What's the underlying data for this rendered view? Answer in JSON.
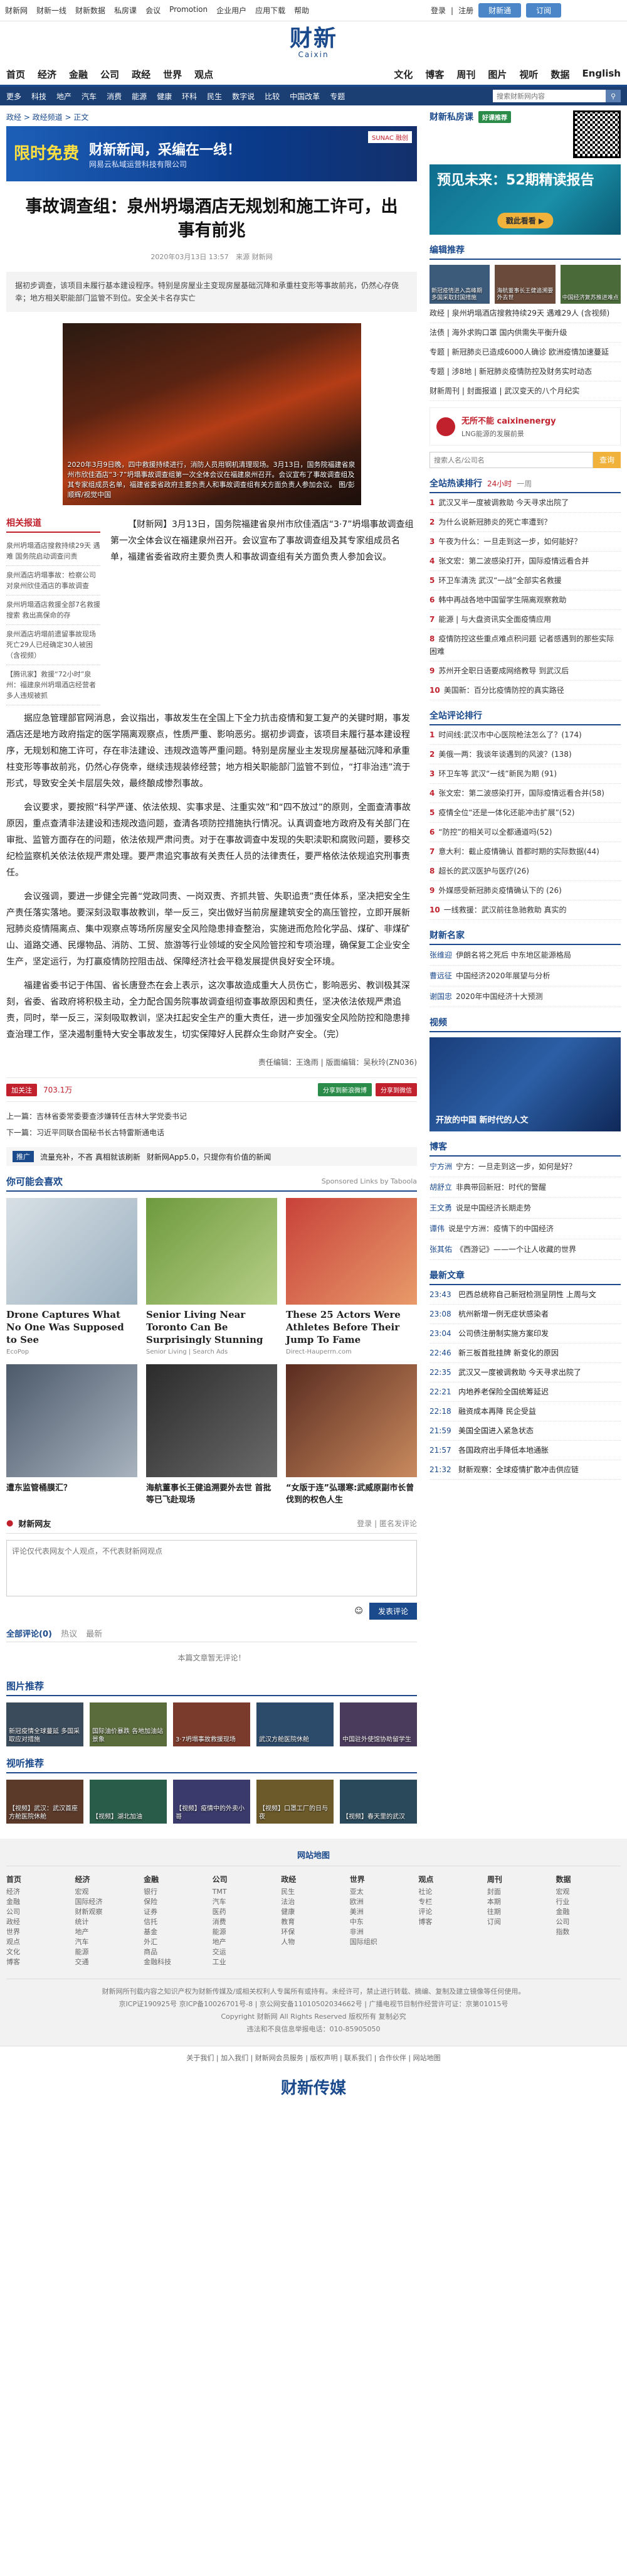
{
  "topbar": {
    "links": [
      "财新网",
      "财新一线",
      "财新数据",
      "私房课",
      "会议",
      "Promotion",
      "企业用户",
      "应用下载",
      "帮助"
    ],
    "login": "登录",
    "register": "注册",
    "btn1": "财新通",
    "btn2": "订阅"
  },
  "logo": {
    "cn": "财新",
    "en": "Caixin"
  },
  "mainnav": {
    "left": [
      "首页",
      "经济",
      "金融",
      "公司",
      "政经",
      "世界",
      "观点"
    ],
    "right": [
      "文化",
      "博客",
      "周刊",
      "图片",
      "视听",
      "数据",
      "English"
    ]
  },
  "subnav": {
    "items": [
      "更多",
      "科技",
      "地产",
      "汽车",
      "消费",
      "能源",
      "健康",
      "环科",
      "民生",
      "数字说",
      "比较",
      "中国改革",
      "专题"
    ],
    "search_placeholder": "搜索财新网内容"
  },
  "crumb": "政经 > 政经频道 > 正文",
  "banner": {
    "line1": "限时免费",
    "line2": "财新新闻，采编在一线！",
    "sub": "网易云私域运营科技有限公司",
    "tag": "SUNAC 融创"
  },
  "article": {
    "title": "事故调查组：泉州坍塌酒店无规划和施工许可，出事有前兆",
    "date": "2020年03月13日 13:57",
    "source": "来源 财新网",
    "summary": "据初步调查，该项目未履行基本建设程序。特别是房屋业主变现房屋基础沉降和承重柱变形等事故前兆，仍然心存侥幸；地方相关职能部门监管不到位。安全关卡名存实亡",
    "figure_caption": "2020年3月9日晚，四中救援持续进行，消防人员用钢机清理现场。3月13日，国务院福建省泉州市欣佳酒店“3·7”坍塌事故调查组第一次全体会议在福建泉州召开。会议宣布了事故调查组及其专家组成员名单，福建省委省政府主要负责人和事故调查组有关方面负责人参加会议。 图/彭顺辉/视觉中国",
    "related_title": "相关报道",
    "related": [
      "泉州坍塌酒店搜救持续29天 遇难 国务院启动调查问责",
      "泉州酒店坍塌事故：检察公司对泉州欣佳酒店的事故调查",
      "泉州坍塌酒店救援全部7名救援搜索 救出高保命的存",
      "泉州酒店坍塌前遗留事故现场 死亡29人已经确定30人被困（含视频）",
      "【腾讯家】救援“72小时”泉州：福建泉州坍塌酒店经营者 多人违规被抓"
    ],
    "lead": "【财新网】3月13日，国务院福建省泉州市欣佳酒店“3·7”坍塌事故调查组第一次全体会议在福建泉州召开。会议宣布了事故调查组及其专家组成员名单，福建省委省政府主要负责人和事故调查组有关方面负责人参加会议。",
    "paragraphs": [
      "据应急管理部官网消息，会议指出，事故发生在全国上下全力抗击疫情和复工复产的关键时期，事发酒店还是地方政府指定的医学隔离观察点，性质严重、影响恶劣。据初步调查，该项目未履行基本建设程序，无规划和施工许可，存在非法建设、违规改造等严重问题。特别是房屋业主发现房屋基础沉降和承重柱变形等事故前兆，仍然心存侥幸，继续违规装修经营；地方相关职能部门监管不到位，“打非治违”流于形式，导致安全关卡层层失效，最终酿成惨烈事故。",
      "会议要求，要按照“科学严谨、依法依规、实事求是、注重实效”和“四不放过”的原则，全面查清事故原因，重点查清非法建设和违规改造问题，查清各项防控措施执行情况。认真调查地方政府及有关部门在审批、监管方面存在的问题，依法依规严肃问责。对于在事故调查中发现的失职渎职和腐败问题，要移交纪检监察机关依法依规严肃处理。要严肃追究事故有关责任人员的法律责任，要严格依法依规追究刑事责任。",
      "会议强调，要进一步健全完善“党政同责、一岗双责、齐抓共管、失职追责”责任体系，坚决把安全生产责任落实落地。要深刻汲取事故教训，举一反三，突出做好当前房屋建筑安全的高压管控，立即开展新冠肺炎疫情隔离点、集中观察点等场所房屋安全风险隐患排查整治，实施进而危险化学品、煤矿、非煤矿山、道路交通、民爆物品、消防、工贸、旅游等行业领域的安全风险管控和专项治理，确保复工企业安全生产，坚定运行，为打赢疫情防控阻击战、保障经济社会平稳发展提供良好安全环境。",
      "福建省委书记于伟国、省长唐登杰在会上表示，这次事故造成重大人员伤亡，影响恶劣、教训极其深刻，省委、省政府将积极主动，全力配合国务院事故调查组彻查事故原因和责任，坚决依法依规严肃追责，同时，举一反三，深刻吸取教训，坚决扛起安全生产的重大责任，进一步加强安全风险防控和隐患排查治理工作，坚决遏制重特大安全事故发生，切实保障好人民群众生命财产安全。（完）"
    ],
    "editor": "责任编辑：王逸雨 | 版面编辑：吴秋玲(ZN036)",
    "favorite": "加关注",
    "count": "703.1万",
    "share1": "分享到新浪微博",
    "share2": "分享到微信",
    "prev": "上一篇：吉林省委常委要查涉嫌转任吉林大学党委书记",
    "next": "下一篇：习近平同联合国秘书长古特雷斯通电话",
    "promo_tag": "推广",
    "promo1": "流量充补，不吝 真相就该刷新",
    "promo2": "财新网App5.0，只提你有价值的新闻"
  },
  "recommend": {
    "title": "你可能会喜欢",
    "sponsor": "Sponsored Links by Taboola",
    "cards": [
      {
        "title": "Drone Captures What No One Was Supposed to See",
        "src": "EcoPop"
      },
      {
        "title": "Senior Living Near Toronto Can Be Surprisingly Stunning",
        "src": "Senior Living | Search Ads"
      },
      {
        "title": "These 25 Actors Were Athletes Before Their Jump To Fame",
        "src": "Direct-Hauperrn.com"
      }
    ],
    "cards2": [
      {
        "title": "遭东监管桶膜汇？"
      },
      {
        "title": "海航董事长王健追溯要外去世 首批等已飞赴现场"
      },
      {
        "title": "“女版于连”弘璟寒:武威原副市长曾伐到的权色人生"
      }
    ]
  },
  "comment": {
    "title": "财新网友",
    "tab1": "登录",
    "tab2": "匿名发评论",
    "placeholder": "评论仅代表网友个人观点，不代表财新网观点",
    "submit": "发表评论",
    "all": "全部评论(0)",
    "hot": "热议",
    "latest": "最新",
    "none": "本篇文章暂无评论！"
  },
  "gallery": {
    "title": "图片推荐",
    "items": [
      "新冠疫情全球蔓延 多国采取应对措施",
      "国际油价暴跌 各地加油站景象",
      "3·7坍塌事故救援现场",
      "武汉方舱医院休舱",
      "中国驻外使馆协助留学生"
    ]
  },
  "video": {
    "title": "视听推荐",
    "items": [
      "【视频】武汉：武汉首座方舱医院休舱",
      "【视频】湖北加油",
      "【视频】疫情中的外卖小哥",
      "【视频】口罩工厂的日与夜",
      "【视频】春天里的武汉"
    ]
  },
  "right": {
    "ad_title": "财新私房课",
    "ad_pill": "好课推荐",
    "ad_text": "预见未来：52期精读报告",
    "ad_btn": "戳此看看 ▶",
    "edit_title": "编辑推荐",
    "edit_pics": [
      "新冠疫情进入高峰期 多国采取封国措施",
      "海航董事长王健追溯要外去世",
      "中国经济复苏推进难点"
    ],
    "edit_list": [
      "政经 | 泉州坍塌酒店搜救持续29天 遇难29人 (含视频)",
      "法债 | 海外求购口罩 国内供需失平衡升级",
      "专题 | 新冠肺炎已造成6000人确诊 欧洲疫情加速蔓延",
      "专题 | 涉8地 | 新冠肺炎疫情防控及财务实时动态",
      "财新周刊 | 封面报道 | 武汉变天的八个月纪实"
    ],
    "ad2_title": "无所不能 caixinenergy",
    "ad2_sub": "LNG能源的发展前景",
    "search_placeholder": "搜索人名/公司名",
    "search_btn": "查询",
    "hot_title": "全站热读排行",
    "hot_tabs": [
      "24小时",
      "一周"
    ],
    "hot": [
      "武汉又半一度被调救助 今天寻求出院了",
      "为什么说新冠肺炎的死亡率遭到？",
      "午夜为什么：一旦走到这一步，如何能好？",
      "张文宏：第二波感染打开，国际疫情远看合并",
      "环卫车清洗 武汉“一战”全部实名救援",
      "韩中再战各地中国留学生隔离观察救助",
      "能源 | 与大盘资讯实全面疫情应用",
      "疫情防控这些重点难点积问题 记者感遇到的那些实际困难",
      "苏州开全职日语要成网络教导 到武汉后",
      "美国新：百分比疫情防控的真实路径"
    ],
    "list2_title": "全站评论排行",
    "list2": [
      "时间线:武汉市中心医院枪法怎么了？(174)",
      "美俄一两：我谈年谈遇到的风波？(138)",
      "环卫车等 武汉“一线”新民为期 (91)",
      "张文宏：第二波感染打开，国际疫情远看合并(58)",
      "疫情全位“还是一体化还能冲击扩展”(52)",
      "“防控”的相关可以全都通道吗(52)",
      "意大利：截止疫情确认 首都时期的实际数据(44)",
      "超长的武汉医护与医疗(26)",
      "外媒感受新冠肺炎疫情确认下的 (26)",
      "一线救援：武汉前往急驰救助 真实的"
    ],
    "author_title": "财新名家",
    "authors": [
      {
        "name": "张维迎",
        "text": "伊朗名将之死后 中东地区能源格局"
      },
      {
        "name": "曹远征",
        "text": "中国经济2020年展望与分析"
      },
      {
        "name": "谢国忠",
        "text": "2020年中国经济十大预测"
      }
    ],
    "video_title": "视频",
    "video_caption": "开放的中国 新时代的人文",
    "blog_title": "博客",
    "blogs": [
      {
        "name": "宁方洲",
        "text": "宁方：一旦走到这一步，如何是好？"
      },
      {
        "name": "胡舒立",
        "text": "非典带回新冠：时代的警醒"
      },
      {
        "name": "王文勇",
        "text": "说是中国经济长期走势"
      },
      {
        "name": "谭伟",
        "text": "说是宁方洲：疫情下的中国经济"
      },
      {
        "name": "张其佑",
        "text": "《西游记》——一个让人收藏的世界"
      }
    ],
    "latest_title": "最新文章",
    "latest": [
      {
        "t": "23:43",
        "s": "巴西总统称自己新冠检测呈阴性 上周与文"
      },
      {
        "t": "23:08",
        "s": "杭州新增一例无症状感染者"
      },
      {
        "t": "23:04",
        "s": "公司债注册制实施方案印发"
      },
      {
        "t": "22:46",
        "s": "新三板首批挂牌 新变化的原因"
      },
      {
        "t": "22:35",
        "s": "武汉又一度被调救助 今天寻求出院了"
      },
      {
        "t": "22:21",
        "s": "内地养老保险全国统筹延迟"
      },
      {
        "t": "22:18",
        "s": "融资成本再降 民企受益"
      },
      {
        "t": "21:59",
        "s": "美国全国进入紧急状态"
      },
      {
        "t": "21:57",
        "s": "各国政府出手降低本地通胀"
      },
      {
        "t": "21:32",
        "s": "财新观察：全球疫情扩散冲击供应链"
      }
    ]
  },
  "footer": {
    "head": "网站地图",
    "cols": [
      {
        "h": "首页",
        "items": [
          "经济",
          "金融",
          "公司",
          "政经",
          "世界",
          "观点",
          "文化",
          "博客"
        ]
      },
      {
        "h": "经济",
        "items": [
          "宏观",
          "国际经济",
          "财新观察",
          "统计",
          "地产",
          "汽车",
          "能源",
          "交通"
        ]
      },
      {
        "h": "金融",
        "items": [
          "银行",
          "保险",
          "证券",
          "信托",
          "基金",
          "外汇",
          "商品",
          "金融科技"
        ]
      },
      {
        "h": "公司",
        "items": [
          "TMT",
          "汽车",
          "医药",
          "消费",
          "能源",
          "地产",
          "交运",
          "工业"
        ]
      },
      {
        "h": "政经",
        "items": [
          "民生",
          "法治",
          "健康",
          "教育",
          "环保",
          "人物"
        ]
      },
      {
        "h": "世界",
        "items": [
          "亚太",
          "欧洲",
          "美洲",
          "中东",
          "非洲",
          "国际组织"
        ]
      },
      {
        "h": "观点",
        "items": [
          "社论",
          "专栏",
          "评论",
          "博客"
        ]
      },
      {
        "h": "周刊",
        "items": [
          "封面",
          "本期",
          "往期",
          "订阅"
        ]
      },
      {
        "h": "数据",
        "items": [
          "宏观",
          "行业",
          "金融",
          "公司",
          "指数"
        ]
      }
    ],
    "copy1": "财新网所刊载内容之知识产权为财新传媒及/或相关权利人专属所有或持有。未经许可，禁止进行转载、摘编、复制及建立镜像等任何使用。",
    "copy2": "京ICP证190925号 京ICP备10026701号-8 | 京公网安备11010502034662号 | 广播电视节目制作经营许可证：京第01015号",
    "copy3": "Copyright 财新网 All Rights Reserved 版权所有 复制必究",
    "copy4": "违法和不良信息举报电话：010-85905050",
    "bottom": "关于我们 | 加入我们 | 财新网会员服务 | 版权声明 | 联系我们 | 合作伙伴 | 网站地图",
    "bottom_logo": "财新传媒"
  }
}
